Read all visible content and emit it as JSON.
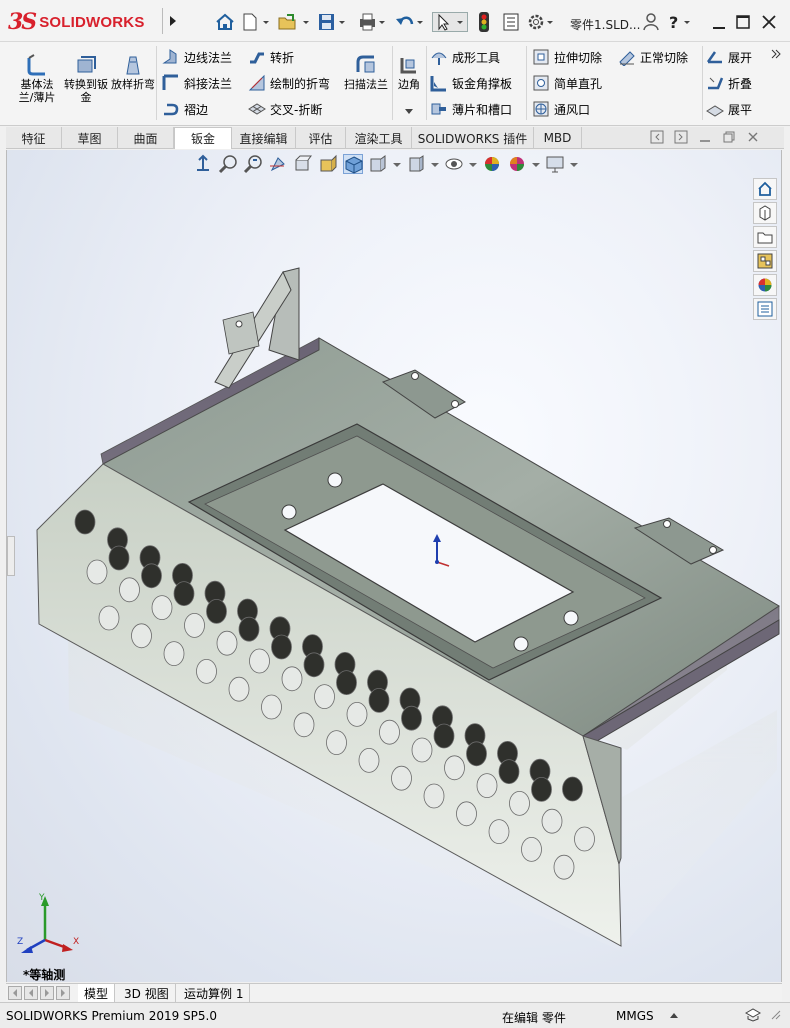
{
  "app": {
    "logo_ds": "3S",
    "logo_text": "SOLIDWORKS",
    "document_title": "零件1.SLD..."
  },
  "ribbon": {
    "big_buttons": [
      {
        "label": "基体法兰/薄片",
        "icon": "base-flange-icon"
      },
      {
        "label": "转换到钣金",
        "icon": "convert-to-sheet-metal-icon"
      },
      {
        "label": "放样折弯",
        "icon": "lofted-bend-icon"
      }
    ],
    "col1": [
      {
        "label": "边线法兰",
        "icon": "edge-flange-icon"
      },
      {
        "label": "斜接法兰",
        "icon": "miter-flange-icon"
      },
      {
        "label": "褶边",
        "icon": "hem-icon"
      }
    ],
    "col2": [
      {
        "label": "转折",
        "icon": "jog-icon"
      },
      {
        "label": "绘制的折弯",
        "icon": "sketched-bend-icon"
      },
      {
        "label": "交叉-折断",
        "icon": "cross-break-icon"
      }
    ],
    "sweep": {
      "label": "扫描法兰",
      "icon": "swept-flange-icon"
    },
    "corner": {
      "label": "边角",
      "icon": "corner-icon"
    },
    "col3": [
      {
        "label": "成形工具",
        "icon": "forming-tool-icon"
      },
      {
        "label": "钣金角撑板",
        "icon": "sheet-metal-gusset-icon"
      },
      {
        "label": "薄片和槽口",
        "icon": "tab-and-slot-icon"
      }
    ],
    "col4": [
      {
        "label": "拉伸切除",
        "icon": "extruded-cut-icon"
      },
      {
        "label": "简单直孔",
        "icon": "simple-hole-icon"
      },
      {
        "label": "通风口",
        "icon": "vent-icon"
      }
    ],
    "col5": [
      {
        "label": "正常切除",
        "icon": "normal-cut-icon"
      }
    ],
    "col6": [
      {
        "label": "展开",
        "icon": "unfold-icon"
      },
      {
        "label": "折叠",
        "icon": "fold-icon"
      },
      {
        "label": "展平",
        "icon": "flatten-icon"
      }
    ]
  },
  "tabs": [
    "特征",
    "草图",
    "曲面",
    "钣金",
    "直接编辑",
    "评估",
    "渲染工具",
    "SOLIDWORKS 插件",
    "MBD"
  ],
  "active_tab": "钣金",
  "viewport": {
    "view_label": "*等轴测",
    "triad": {
      "x": "X",
      "y": "Y",
      "z": "Z"
    }
  },
  "bottom_tabs": [
    "模型",
    "3D 视图",
    "运动算例 1"
  ],
  "status": {
    "product": "SOLIDWORKS Premium 2019 SP5.0",
    "mode": "在编辑 零件",
    "units": "MMGS"
  },
  "colors": {
    "brand": "#d8202c",
    "metal_top": "#8a9a90",
    "metal_edge": "#6f6874",
    "active_tab": "#ffffff"
  }
}
